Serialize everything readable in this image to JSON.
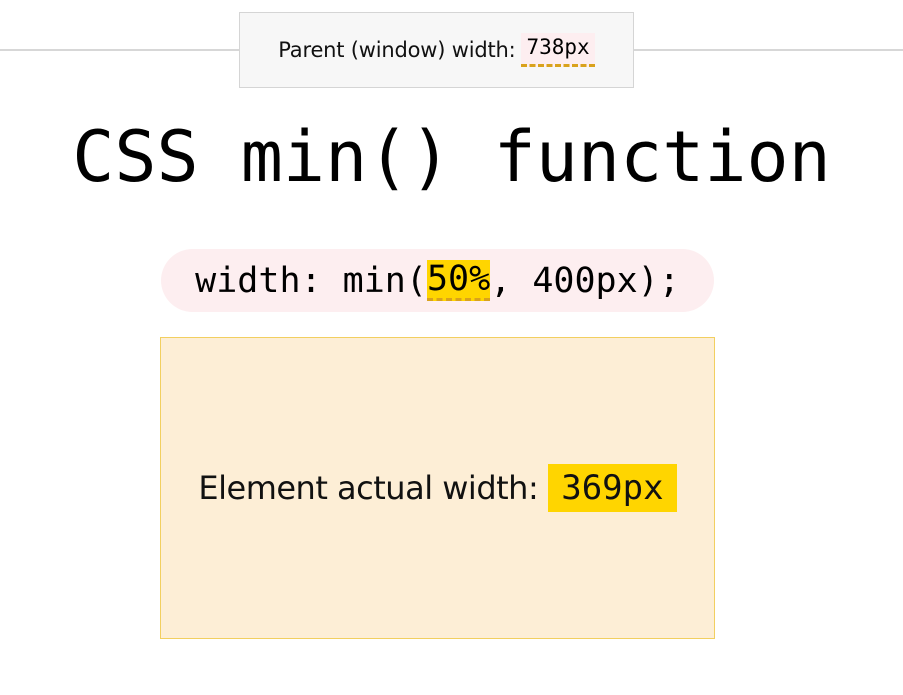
{
  "parent_width": {
    "label": "Parent (window) width:",
    "value": "738px"
  },
  "title": "CSS min() function",
  "css_rule": {
    "prefix": "width: min(",
    "percent": "50%",
    "suffix": ", 400px);"
  },
  "element_width": {
    "label": "Element actual width:",
    "value": "369px"
  },
  "colors": {
    "highlight_yellow": "#ffd500",
    "dashed_underline": "#d9a21c",
    "pill_pink": "#fdeef0",
    "element_bg": "#fdeed6",
    "element_border": "#f2cf60"
  }
}
